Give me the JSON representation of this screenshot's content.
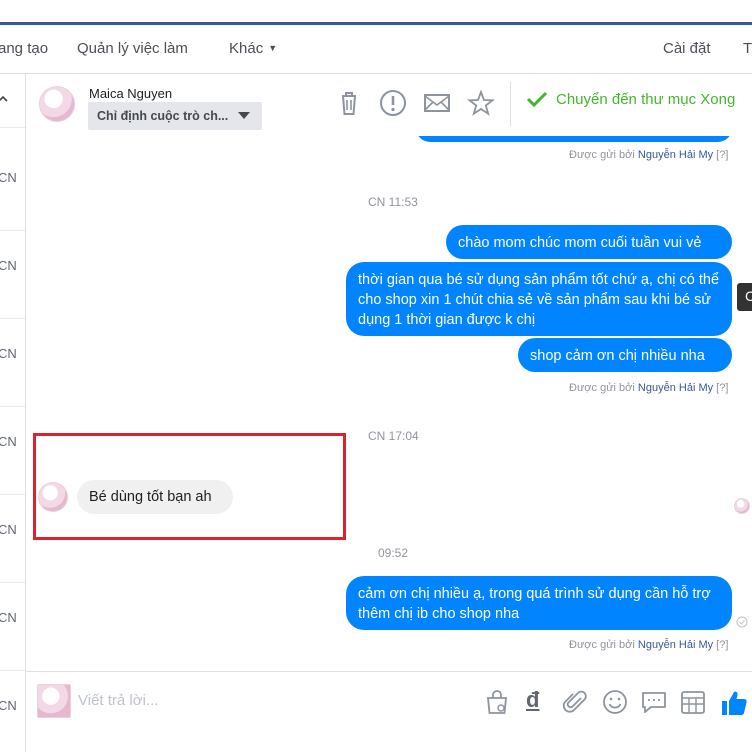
{
  "nav": {
    "item1": "ang tạo",
    "item2": "Quản lý việc làm",
    "item3": "Khác",
    "settings": "Cài đặt",
    "more": "T"
  },
  "left_rail": {
    "labels": [
      "CN",
      "CN",
      "CN",
      "CN",
      "CN",
      "CN",
      "CN"
    ]
  },
  "header": {
    "contact_name": "Maica Nguyen",
    "assign_label": "Chỉ định cuộc trò ch...",
    "move_label": "Chuyển đến thư mục Xong",
    "icons": [
      "trash-icon",
      "alert-icon",
      "mail-icon",
      "star-icon",
      "check-icon"
    ]
  },
  "thread": {
    "messages": [
      {
        "sender": "page",
        "sent_by_prefix": "Được gửi bởi",
        "sent_by_name": "Nguyễn Hải My",
        "help": "[?]"
      },
      {
        "timestamp": "CN 11:53"
      },
      {
        "sender": "page",
        "text": "chào mom chúc mom cuối tuần vui vẻ"
      },
      {
        "sender": "page",
        "text": "thời gian qua bé sử dụng sản phẩm tốt chứ ạ, chị có thể cho shop xin 1 chút chia sẻ về sản phẩm sau khi bé sử dụng 1 thời gian được k chị"
      },
      {
        "sender": "page",
        "text": "shop cảm ơn chị nhiều nha",
        "sent_by_prefix": "Được gửi bởi",
        "sent_by_name": "Nguyễn Hải My",
        "help": "[?]"
      },
      {
        "timestamp": "CN 17:04"
      },
      {
        "sender": "customer",
        "text": "Bé dùng tốt bạn ah"
      },
      {
        "timestamp": "09:52"
      },
      {
        "sender": "page",
        "text": "cảm ơn chị nhiều ạ, trong quá trình sử dụng cần hỗ trợ thêm chị ib cho shop nha",
        "sent_by_prefix": "Được gửi bởi",
        "sent_by_name": "Nguyễn Hải My",
        "help": "[?]"
      }
    ],
    "tooltip": "C"
  },
  "composer": {
    "placeholder": "Viết trả lời...",
    "icons": [
      "shopping-bag-icon",
      "dong-currency-icon",
      "paperclip-icon",
      "emoji-icon",
      "saved-reply-icon",
      "appointment-icon",
      "like-icon"
    ],
    "dong_glyph": "đ"
  },
  "colors": {
    "accent": "#0084ff",
    "nav_border": "#3b5998",
    "done_green": "#42b72a",
    "highlight_red": "#e0202a"
  }
}
